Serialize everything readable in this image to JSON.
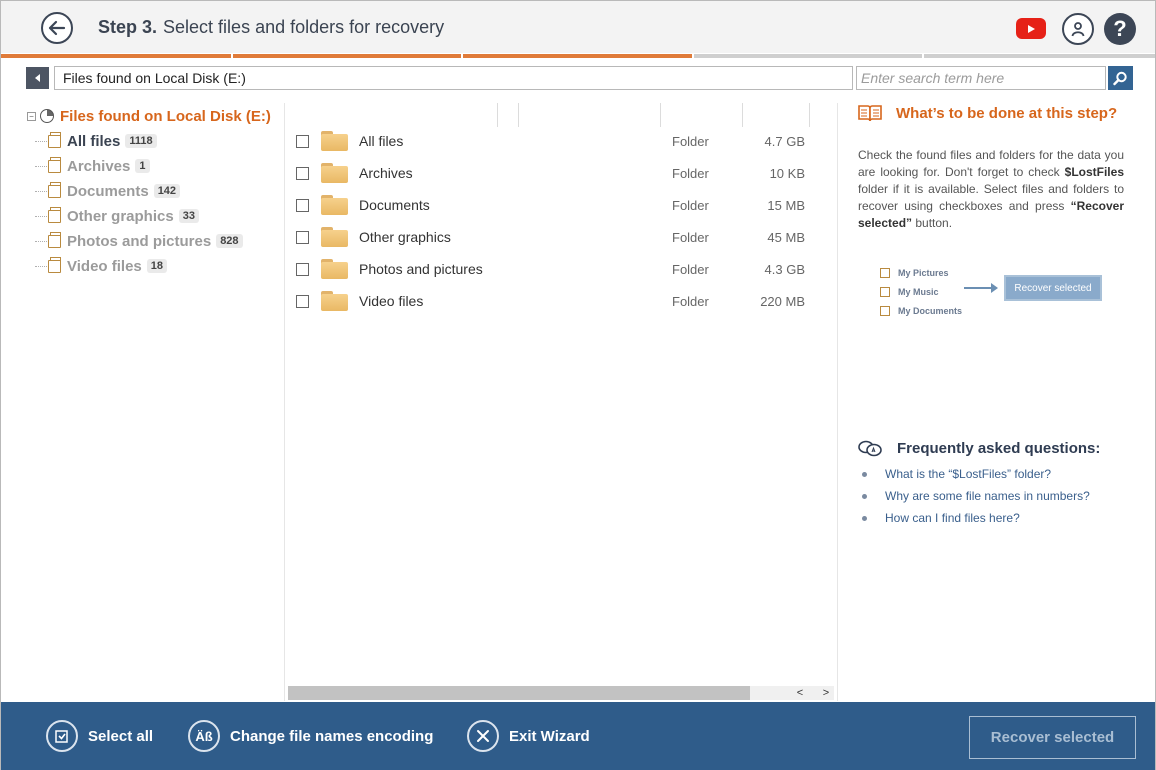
{
  "header": {
    "step_number": "Step 3.",
    "step_title": "Select files and folders for recovery"
  },
  "progress": {
    "segments_done": 3,
    "segments_total": 5,
    "accent_color": "#e07b39",
    "track_color": "#cfcfcf"
  },
  "address": {
    "path": "Files found on Local Disk (E:)",
    "search_placeholder": "Enter search term here"
  },
  "tree": {
    "root_label": "Files found on Local Disk (E:)",
    "items": [
      {
        "label": "All files",
        "count": "1118",
        "active": true
      },
      {
        "label": "Archives",
        "count": "1",
        "active": false
      },
      {
        "label": "Documents",
        "count": "142",
        "active": false
      },
      {
        "label": "Other graphics",
        "count": "33",
        "active": false
      },
      {
        "label": "Photos and pictures",
        "count": "828",
        "active": false
      },
      {
        "label": "Video files",
        "count": "18",
        "active": false
      }
    ]
  },
  "files": [
    {
      "name": "All files",
      "type": "Folder",
      "size": "4.7 GB"
    },
    {
      "name": "Archives",
      "type": "Folder",
      "size": "10 KB"
    },
    {
      "name": "Documents",
      "type": "Folder",
      "size": "15 MB"
    },
    {
      "name": "Other graphics",
      "type": "Folder",
      "size": "45 MB"
    },
    {
      "name": "Photos and pictures",
      "type": "Folder",
      "size": "4.3 GB"
    },
    {
      "name": "Video files",
      "type": "Folder",
      "size": "220 MB"
    }
  ],
  "help": {
    "title": "What’s to be done at this step?",
    "text_1": "Check the found files and folders for the data you are looking for. Don't forget to check ",
    "text_bold_1": "$LostFiles",
    "text_2": " folder if it is available. Select files and folders to recover using checkboxes and press ",
    "text_bold_2": "“Recover selected”",
    "text_3": " button.",
    "demo_items": [
      "My Pictures",
      "My Music",
      "My Documents"
    ],
    "demo_button": "Recover selected",
    "faq_title": "Frequently asked questions:",
    "faq": [
      "What is the “$LostFiles” folder?",
      "Why are some file names in numbers?",
      "How can I find files here?"
    ]
  },
  "footer": {
    "select_all": "Select all",
    "encoding": "Change file names encoding",
    "encoding_icon_text": "Äß",
    "exit": "Exit Wizard",
    "recover": "Recover selected"
  },
  "colors": {
    "brand_orange": "#d7661c",
    "footer_blue": "#2f5c8a",
    "youtube_red": "#e62117"
  },
  "icons": [
    "back-arrow-icon",
    "youtube-icon",
    "user-icon",
    "help-icon",
    "search-icon",
    "folder-icon",
    "book-icon",
    "faq-icon",
    "select-all-icon",
    "encoding-icon",
    "close-icon"
  ]
}
